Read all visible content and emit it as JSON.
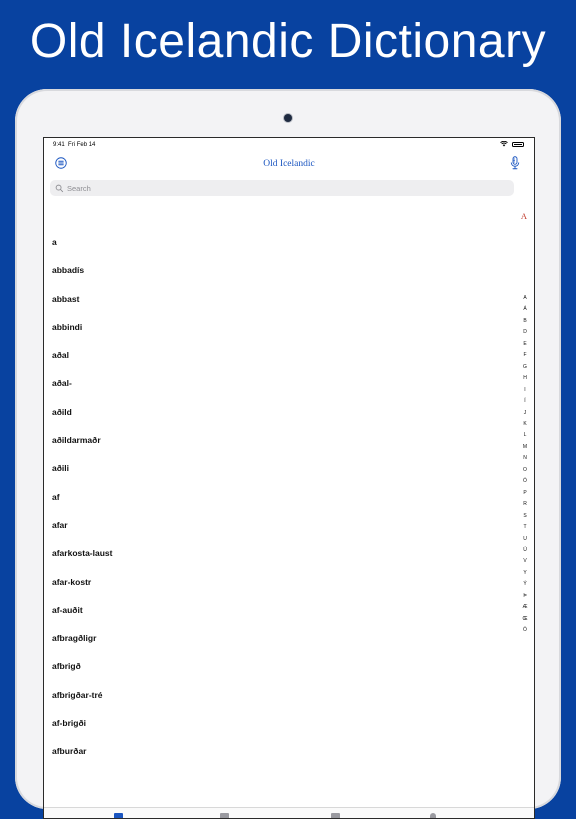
{
  "banner": {
    "title": "Old Icelandic Dictionary"
  },
  "status_bar": {
    "time": "9:41",
    "date": "Fri Feb 14",
    "icons": [
      "wifi-icon",
      "battery-icon"
    ]
  },
  "nav": {
    "title": "Old Icelandic",
    "left_icon": "menu-icon",
    "right_icon": "microphone-icon"
  },
  "search": {
    "placeholder": "Search",
    "value": ""
  },
  "section_header": "A",
  "words": [
    "a",
    "abbadís",
    "abbast",
    "abbindi",
    "aðal",
    "aðal-",
    "aðild",
    "aðildarmaðr",
    "aðili",
    "af",
    "afar",
    "afarkosta-laust",
    "afar-kostr",
    "af-auðit",
    "afbragðligr",
    "afbrigð",
    "afbrigðar-tré",
    "af-brigði",
    "afburðar"
  ],
  "index_letters": [
    "A",
    "Á",
    "B",
    "D",
    "E",
    "F",
    "G",
    "H",
    "I",
    "Í",
    "J",
    "K",
    "L",
    "M",
    "N",
    "O",
    "Ó",
    "P",
    "R",
    "S",
    "T",
    "U",
    "Ú",
    "V",
    "Y",
    "Ý",
    "Þ",
    "Æ",
    "Œ",
    "Ö"
  ],
  "tabs": [
    {
      "name": "tab-dictionary",
      "active": true
    },
    {
      "name": "tab-favorites",
      "active": false
    },
    {
      "name": "tab-history",
      "active": false
    },
    {
      "name": "tab-settings",
      "active": false
    }
  ],
  "colors": {
    "background": "#0842a0",
    "accent": "#1a55c0",
    "section_header": "#c0392b",
    "tab_active": "#1a55c0",
    "tab_inactive": "#9a9aa0"
  }
}
